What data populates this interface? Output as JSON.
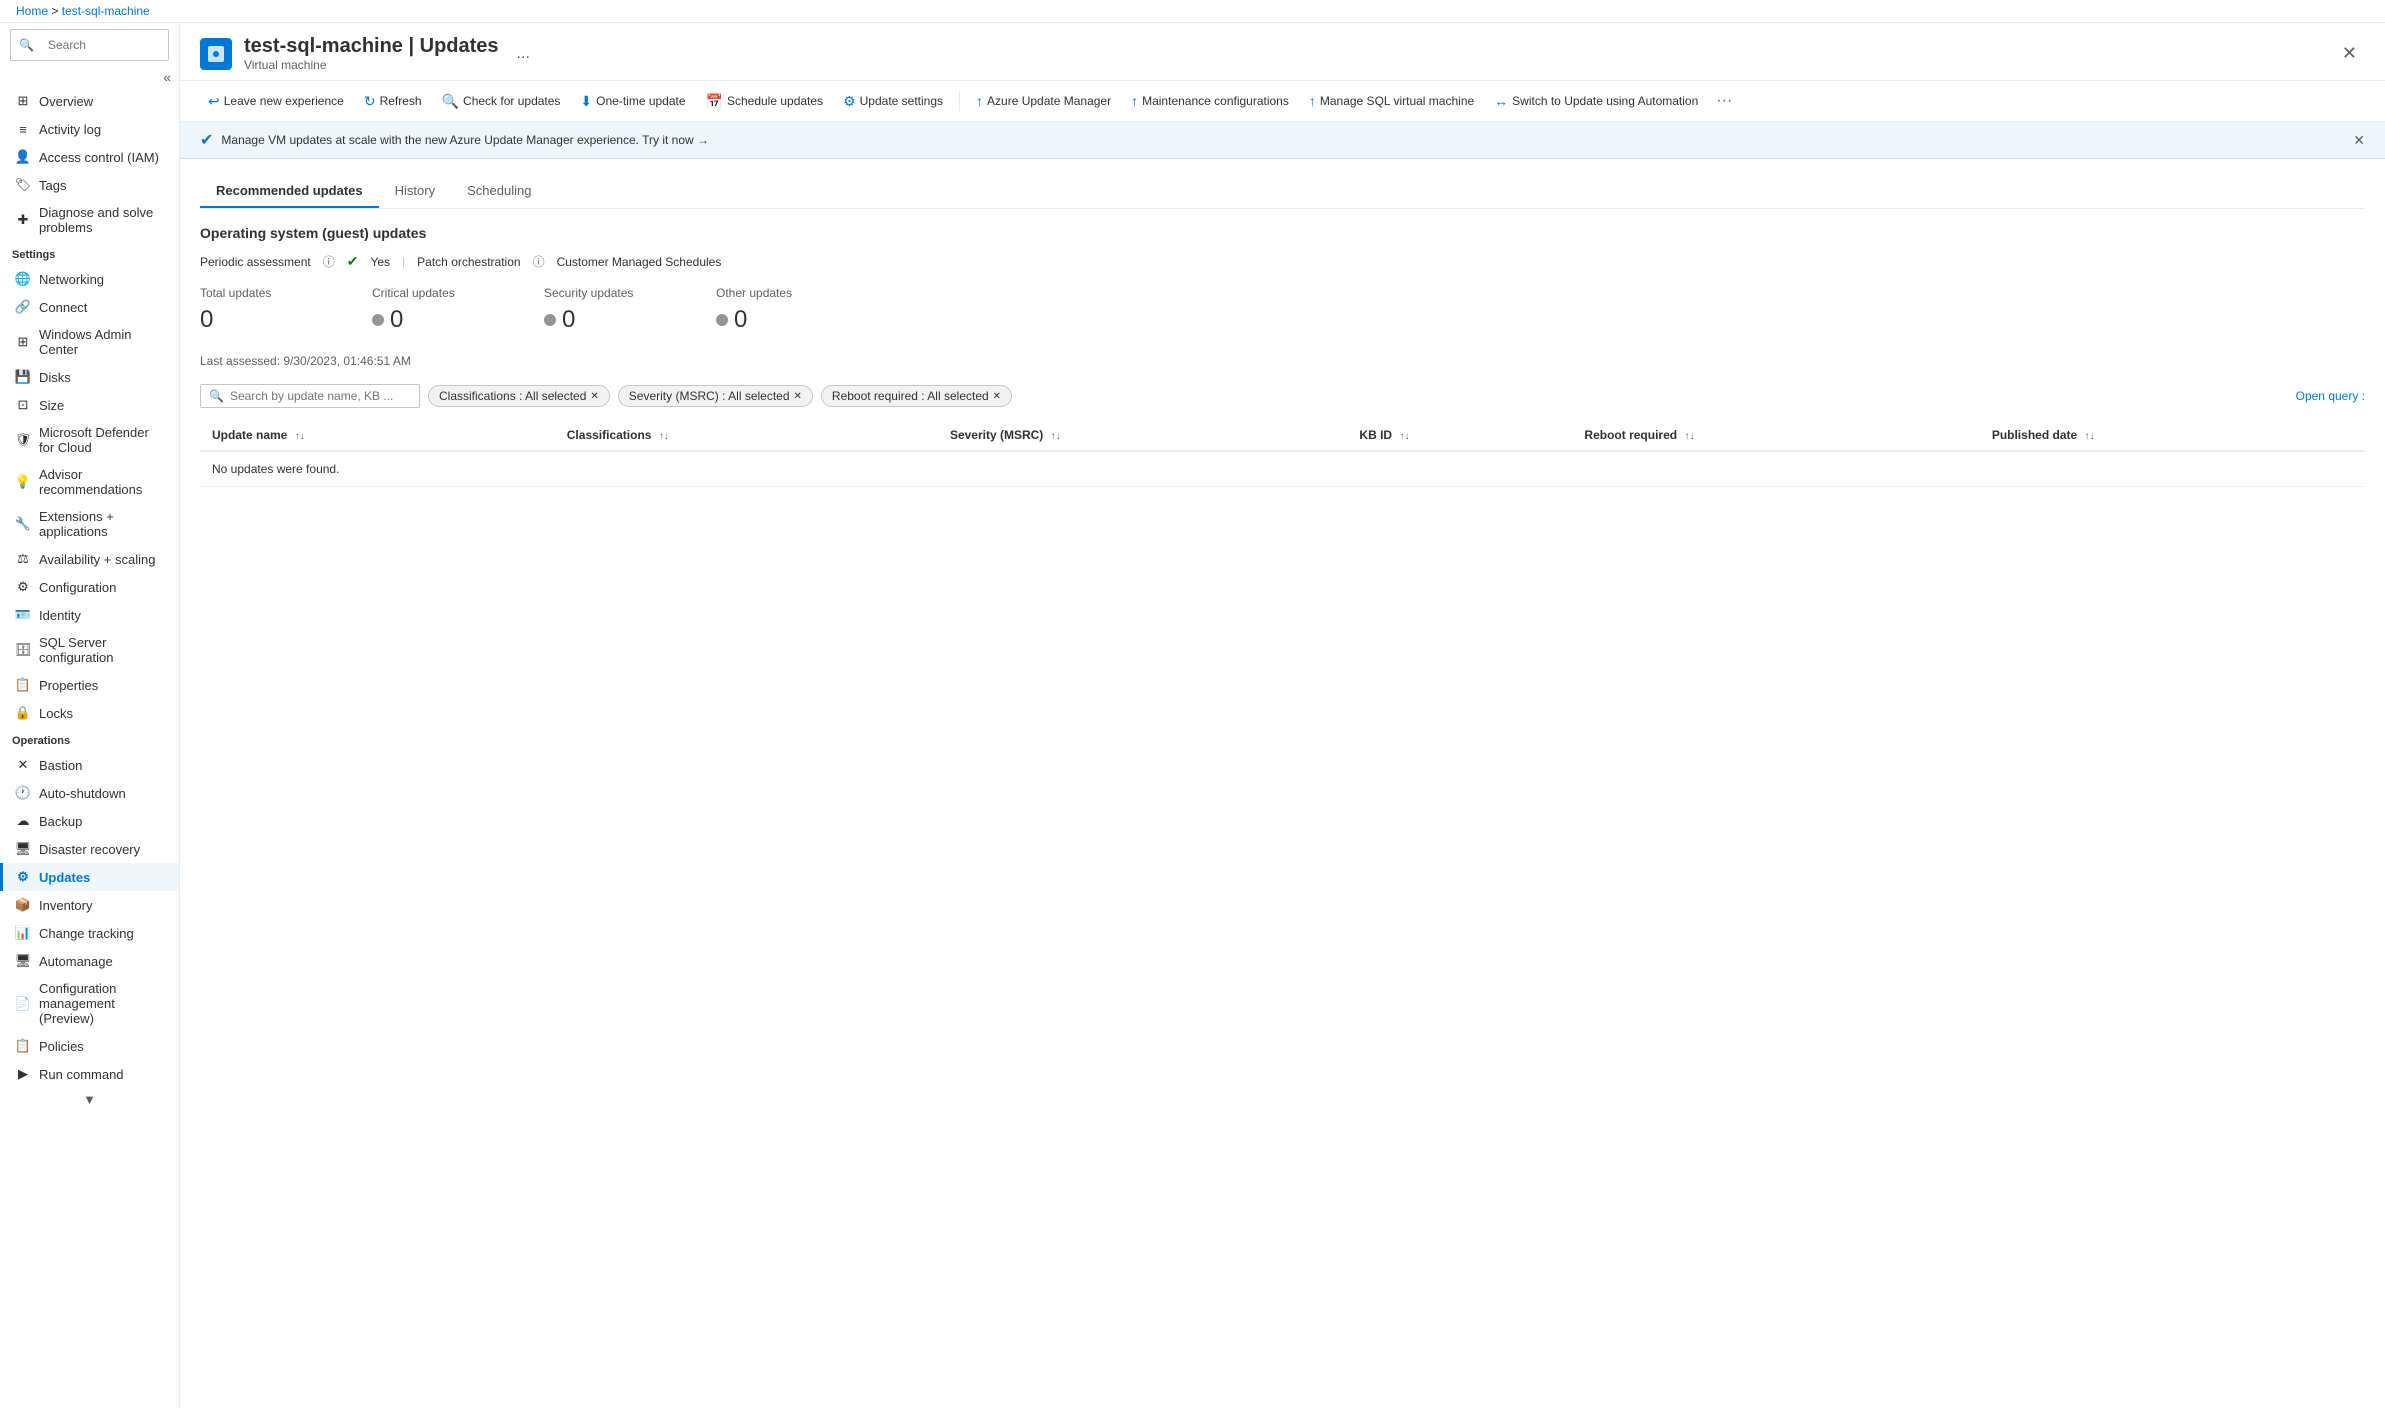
{
  "breadcrumb": {
    "home": "Home",
    "vm": "test-sql-machine"
  },
  "page": {
    "title": "test-sql-machine | Updates",
    "subtitle": "Virtual machine",
    "ellipsis": "...",
    "close_label": "✕"
  },
  "toolbar": {
    "buttons": [
      {
        "id": "leave-new-experience",
        "icon": "↩",
        "label": "Leave new experience"
      },
      {
        "id": "refresh",
        "icon": "↻",
        "label": "Refresh"
      },
      {
        "id": "check-for-updates",
        "icon": "🔍",
        "label": "Check for updates"
      },
      {
        "id": "one-time-update",
        "icon": "⬇",
        "label": "One-time update"
      },
      {
        "id": "schedule-updates",
        "icon": "📅",
        "label": "Schedule updates"
      },
      {
        "id": "update-settings",
        "icon": "⚙",
        "label": "Update settings"
      },
      {
        "id": "azure-update-manager",
        "icon": "↑",
        "label": "Azure Update Manager"
      },
      {
        "id": "maintenance-configurations",
        "icon": "↑",
        "label": "Maintenance configurations"
      },
      {
        "id": "manage-sql-vm",
        "icon": "↑",
        "label": "Manage SQL virtual machine"
      },
      {
        "id": "switch-to-update-automation",
        "icon": "↔",
        "label": "Switch to Update using Automation"
      }
    ]
  },
  "banner": {
    "text": "Manage VM updates at scale with the new Azure Update Manager experience. Try it now →"
  },
  "tabs": [
    {
      "id": "recommended-updates",
      "label": "Recommended updates",
      "active": true
    },
    {
      "id": "history",
      "label": "History",
      "active": false
    },
    {
      "id": "scheduling",
      "label": "Scheduling",
      "active": false
    }
  ],
  "content": {
    "section_title": "Operating system (guest) updates",
    "assessment": {
      "periodic_label": "Periodic assessment",
      "periodic_value": "Yes",
      "patch_label": "Patch orchestration",
      "customer_label": "Customer Managed Schedules"
    },
    "update_cards": [
      {
        "label": "Total updates",
        "value": "0",
        "show_dot": false
      },
      {
        "label": "Critical updates",
        "value": "0",
        "show_dot": true
      },
      {
        "label": "Security updates",
        "value": "0",
        "show_dot": true
      },
      {
        "label": "Other updates",
        "value": "0",
        "show_dot": true
      }
    ],
    "last_assessed": "Last assessed: 9/30/2023, 01:46:51 AM",
    "filters": {
      "search_placeholder": "Search by update name, KB ...",
      "tags": [
        {
          "id": "classifications",
          "label": "Classifications : All selected"
        },
        {
          "id": "severity",
          "label": "Severity (MSRC) : All selected"
        },
        {
          "id": "reboot",
          "label": "Reboot required : All selected"
        }
      ],
      "open_query": "Open query :"
    },
    "table": {
      "columns": [
        {
          "id": "update-name",
          "label": "Update name"
        },
        {
          "id": "classifications",
          "label": "Classifications"
        },
        {
          "id": "severity",
          "label": "Severity (MSRC)"
        },
        {
          "id": "kb-id",
          "label": "KB ID"
        },
        {
          "id": "reboot-required",
          "label": "Reboot required"
        },
        {
          "id": "published-date",
          "label": "Published date"
        }
      ],
      "empty_message": "No updates were found."
    }
  },
  "sidebar": {
    "search_placeholder": "Search",
    "sections": [
      {
        "id": "general",
        "label": null,
        "items": [
          {
            "id": "overview",
            "icon": "⊞",
            "label": "Overview",
            "active": false
          },
          {
            "id": "activity-log",
            "icon": "≡",
            "label": "Activity log",
            "active": false
          },
          {
            "id": "access-control",
            "icon": "👤",
            "label": "Access control (IAM)",
            "active": false
          },
          {
            "id": "tags",
            "icon": "🏷",
            "label": "Tags",
            "active": false
          },
          {
            "id": "diagnose",
            "icon": "✚",
            "label": "Diagnose and solve problems",
            "active": false
          }
        ]
      },
      {
        "id": "settings",
        "label": "Settings",
        "items": [
          {
            "id": "networking",
            "icon": "🌐",
            "label": "Networking",
            "active": false
          },
          {
            "id": "connect",
            "icon": "🔗",
            "label": "Connect",
            "active": false
          },
          {
            "id": "windows-admin-center",
            "icon": "⊞",
            "label": "Windows Admin Center",
            "active": false
          },
          {
            "id": "disks",
            "icon": "💾",
            "label": "Disks",
            "active": false
          },
          {
            "id": "size",
            "icon": "⊡",
            "label": "Size",
            "active": false
          },
          {
            "id": "microsoft-defender",
            "icon": "🛡",
            "label": "Microsoft Defender for Cloud",
            "active": false
          },
          {
            "id": "advisor-recommendations",
            "icon": "💡",
            "label": "Advisor recommendations",
            "active": false
          },
          {
            "id": "extensions-applications",
            "icon": "🔧",
            "label": "Extensions + applications",
            "active": false
          },
          {
            "id": "availability-scaling",
            "icon": "⚖",
            "label": "Availability + scaling",
            "active": false
          },
          {
            "id": "configuration",
            "icon": "⚙",
            "label": "Configuration",
            "active": false
          },
          {
            "id": "identity",
            "icon": "🪪",
            "label": "Identity",
            "active": false
          },
          {
            "id": "sql-server-configuration",
            "icon": "🗄",
            "label": "SQL Server configuration",
            "active": false
          },
          {
            "id": "properties",
            "icon": "📋",
            "label": "Properties",
            "active": false
          },
          {
            "id": "locks",
            "icon": "🔒",
            "label": "Locks",
            "active": false
          }
        ]
      },
      {
        "id": "operations",
        "label": "Operations",
        "items": [
          {
            "id": "bastion",
            "icon": "✕",
            "label": "Bastion",
            "active": false
          },
          {
            "id": "auto-shutdown",
            "icon": "🕐",
            "label": "Auto-shutdown",
            "active": false
          },
          {
            "id": "backup",
            "icon": "☁",
            "label": "Backup",
            "active": false
          },
          {
            "id": "disaster-recovery",
            "icon": "🖥",
            "label": "Disaster recovery",
            "active": false
          },
          {
            "id": "updates",
            "icon": "⚙",
            "label": "Updates",
            "active": true
          },
          {
            "id": "inventory",
            "icon": "📦",
            "label": "Inventory",
            "active": false
          },
          {
            "id": "change-tracking",
            "icon": "📊",
            "label": "Change tracking",
            "active": false
          },
          {
            "id": "automanage",
            "icon": "🖥",
            "label": "Automanage",
            "active": false
          },
          {
            "id": "configuration-management",
            "icon": "📄",
            "label": "Configuration management (Preview)",
            "active": false
          },
          {
            "id": "policies",
            "icon": "📋",
            "label": "Policies",
            "active": false
          },
          {
            "id": "run-command",
            "icon": "▶",
            "label": "Run command",
            "active": false
          }
        ]
      }
    ]
  }
}
